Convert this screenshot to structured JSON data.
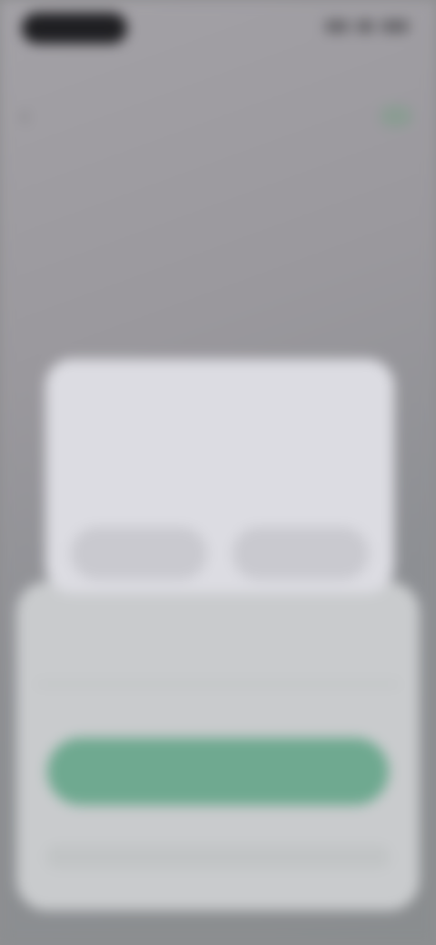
{
  "status_bar": {
    "time": "9:41"
  },
  "header": {
    "back_icon": "chevron-left-icon",
    "title": ""
  },
  "dialog": {
    "title": "",
    "body": "",
    "left_button_label": "",
    "right_button_label": ""
  },
  "sheet": {
    "title": "",
    "caption": "",
    "primary_button_label": ""
  },
  "colors": {
    "accent": "#6fa990",
    "background": "#9a989d",
    "sheet": "#c9cbcd",
    "dialog": "#dcdce2"
  }
}
